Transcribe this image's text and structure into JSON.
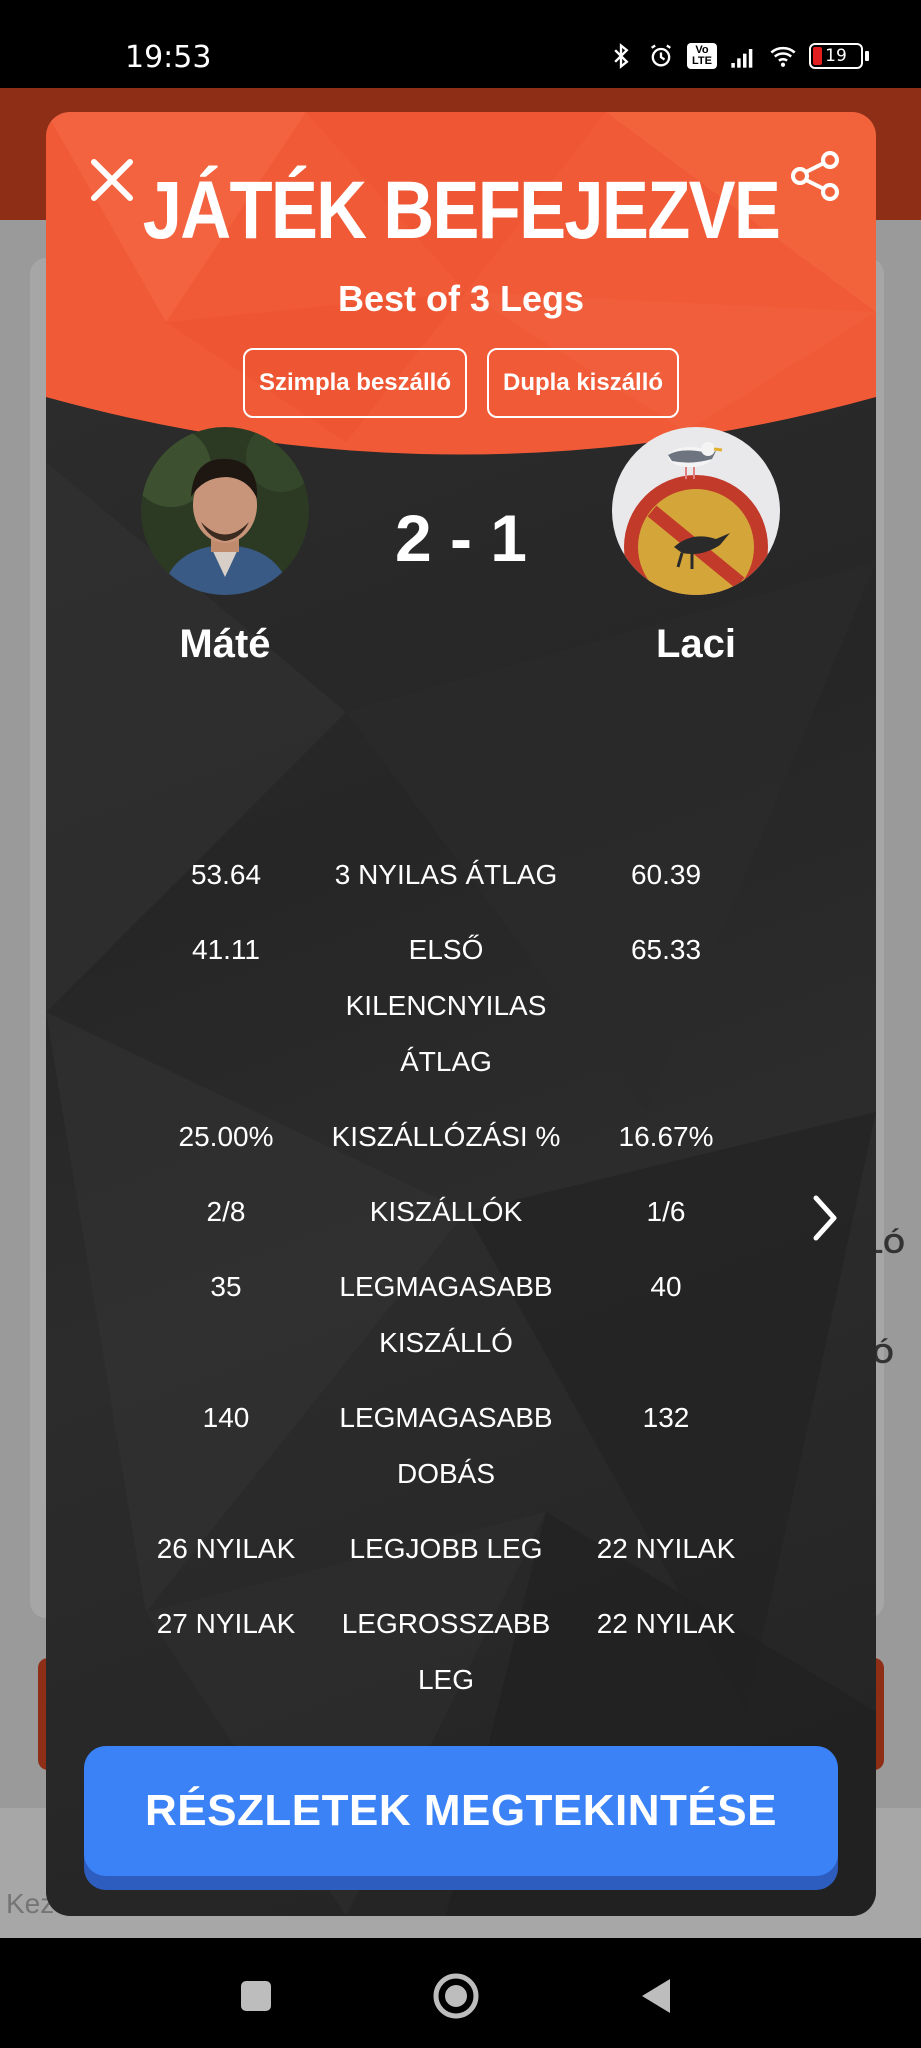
{
  "status_bar": {
    "time": "19:53",
    "battery": "19",
    "battery_level": 0.19,
    "volte_label": "Vo LTE",
    "icons": [
      "bluetooth-icon",
      "alarm-icon",
      "volte-icon",
      "signal-icon",
      "wifi-icon",
      "battery-icon"
    ]
  },
  "background": {
    "footer_text": "Kez",
    "edge_text_1": "LÓ",
    "edge_text_2": "Ó"
  },
  "modal": {
    "title": "JÁTÉK BEFEJEZVE",
    "subtitle": "Best of 3 Legs",
    "tags": [
      "Szimpla beszálló",
      "Dupla kiszálló"
    ],
    "score": "2 - 1",
    "players": {
      "left": {
        "name": "Máté",
        "avatar": "person-photo"
      },
      "right": {
        "name": "Laci",
        "avatar": "no-birds-sign-photo"
      }
    },
    "stats": [
      {
        "left": "53.64",
        "label": "3 NYILAS ÁTLAG",
        "right": "60.39"
      },
      {
        "left": "41.11",
        "label": "ELSŐ KILENCNYILAS ÁTLAG",
        "right": "65.33"
      },
      {
        "left": "25.00%",
        "label": "KISZÁLLÓZÁSI %",
        "right": "16.67%"
      },
      {
        "left": "2/8",
        "label": "KISZÁLLÓK",
        "right": "1/6"
      },
      {
        "left": "35",
        "label": "LEGMAGASABB KISZÁLLÓ",
        "right": "40"
      },
      {
        "left": "140",
        "label": "LEGMAGASABB DOBÁS",
        "right": "132"
      },
      {
        "left": "26 NYILAK",
        "label": "LEGJOBB LEG",
        "right": "22 NYILAK"
      },
      {
        "left": "27 NYILAK",
        "label": "LEGROSSZABB LEG",
        "right": "22 NYILAK"
      }
    ],
    "details_button": "RÉSZLETEK MEGTEKINTÉSE"
  },
  "colors": {
    "header": "#f15a37",
    "modal_bg": "#2a2a2a",
    "button": "#3a82f6"
  }
}
